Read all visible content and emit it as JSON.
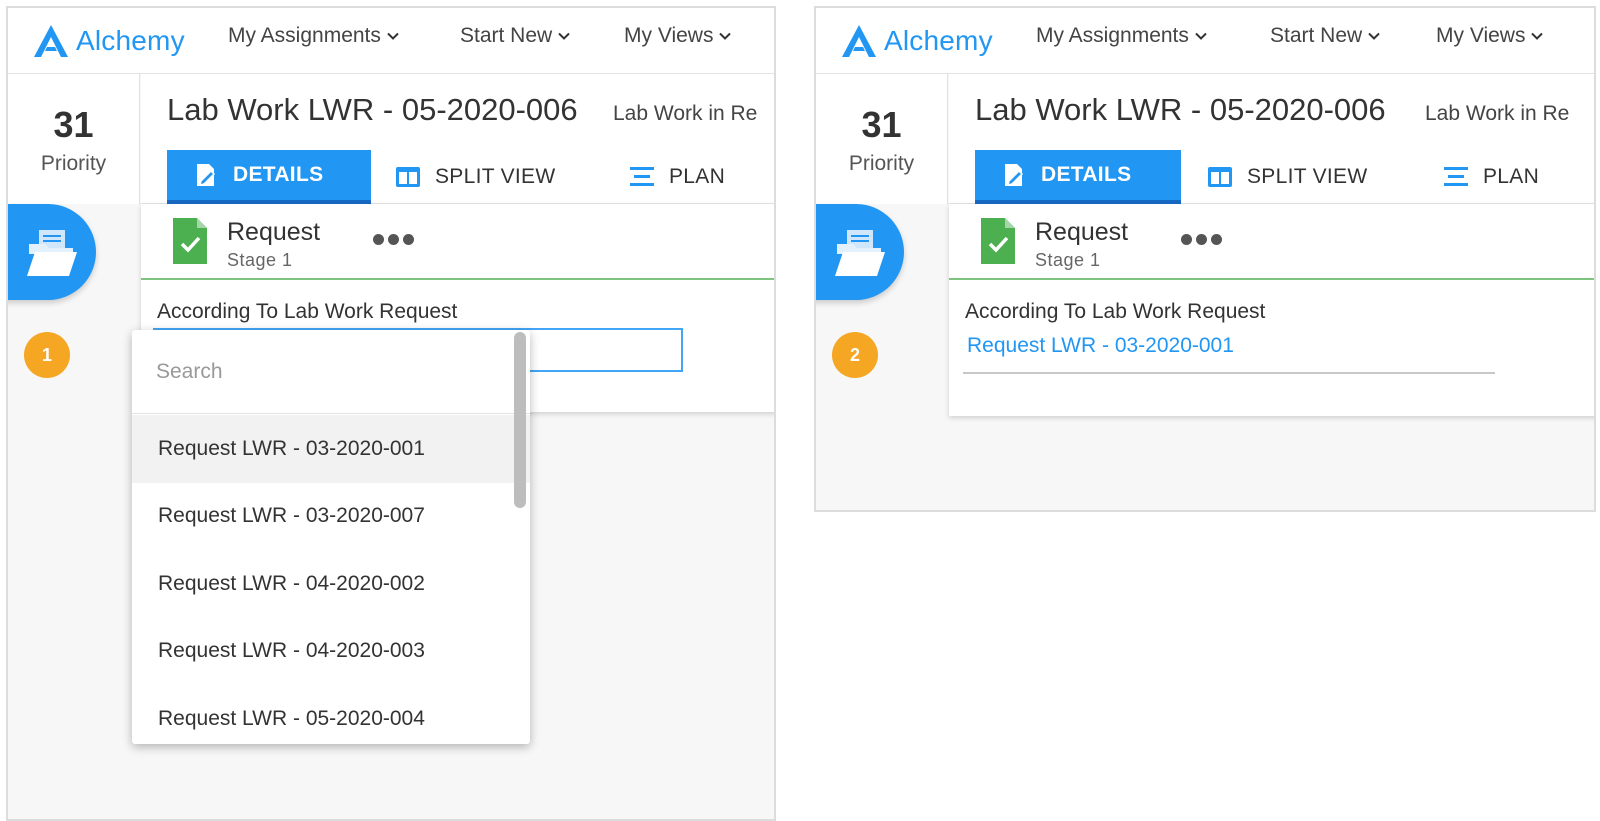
{
  "app": {
    "brand": "Alchemy",
    "accent_color": "#2196f3",
    "step_badge_color": "#f5a623"
  },
  "nav": {
    "my_assignments": "My Assignments",
    "start_new": "Start New",
    "my_views": "My Views"
  },
  "priority": {
    "value": "31",
    "label": "Priority"
  },
  "record": {
    "title": "Lab Work LWR - 05-2020-006",
    "subtitle": "Lab Work in Re"
  },
  "tabs": {
    "details": "DETAILS",
    "split_view": "SPLIT VIEW",
    "plan": "PLAN"
  },
  "card": {
    "title": "Request",
    "stage": "Stage 1",
    "field_label": "According To Lab Work Request"
  },
  "panel1": {
    "step": "1",
    "dropdown": {
      "search_placeholder": "Search",
      "items": [
        "Request LWR - 03-2020-001",
        "Request LWR - 03-2020-007",
        "Request LWR - 04-2020-002",
        "Request LWR - 04-2020-003",
        "Request LWR - 05-2020-004"
      ]
    }
  },
  "panel2": {
    "step": "2",
    "selected_value": "Request LWR - 03-2020-001"
  }
}
